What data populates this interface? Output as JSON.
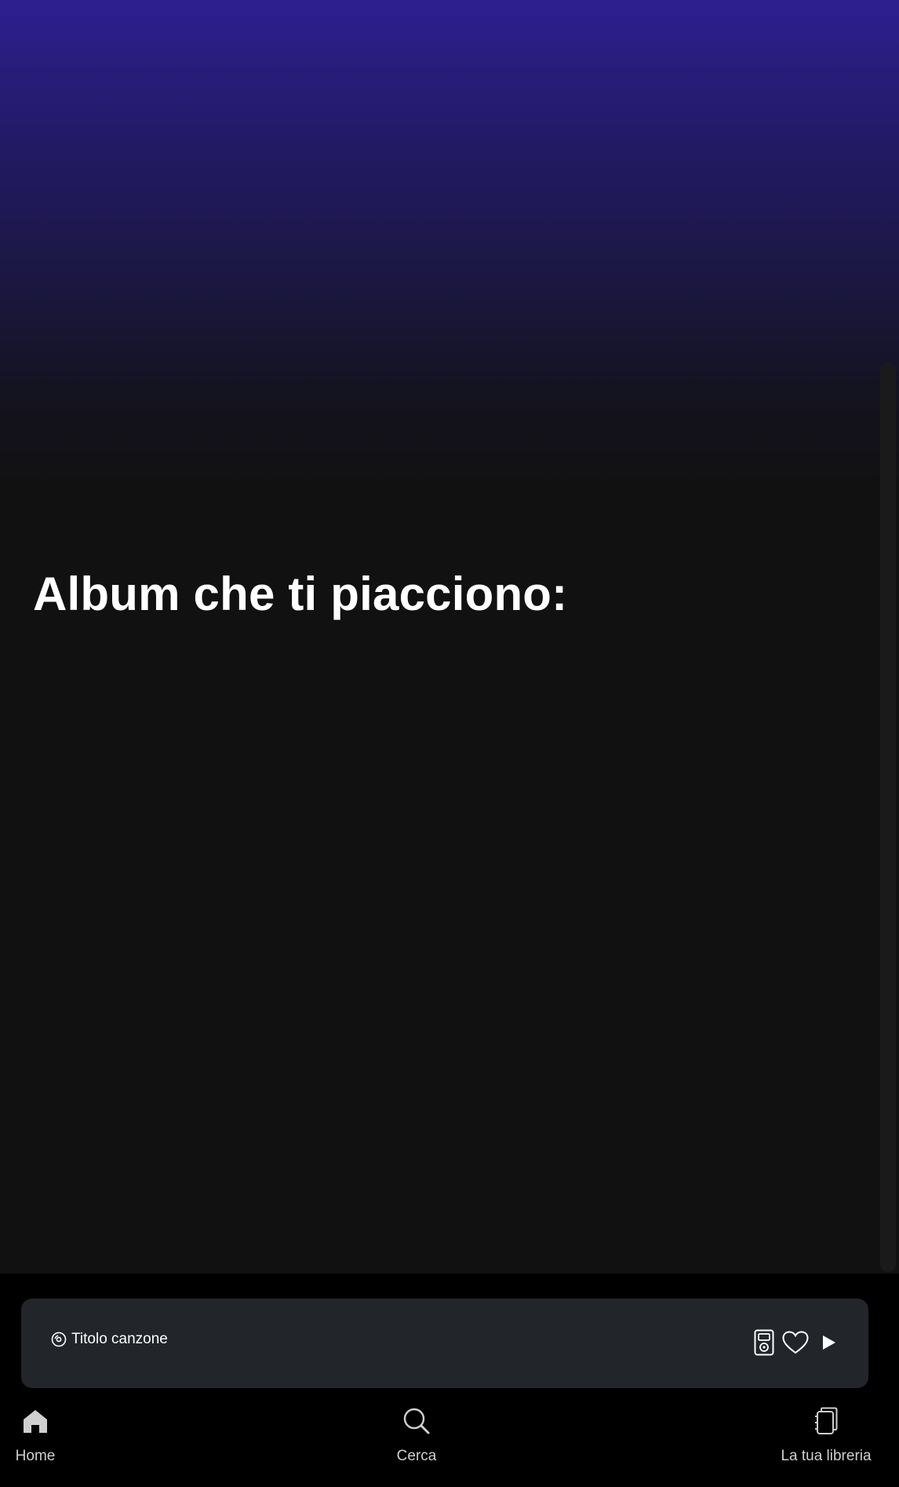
{
  "main": {
    "heading": "Album che ti piacciono:"
  },
  "player": {
    "track_title": "Titolo canzone",
    "icons": {
      "track": "disc-icon",
      "device": "speaker-device-icon",
      "like": "heart-icon",
      "play": "play-icon"
    }
  },
  "nav": {
    "items": [
      {
        "label": "Home",
        "icon": "home-icon"
      },
      {
        "label": "Cerca",
        "icon": "search-icon"
      },
      {
        "label": "La tua libreria",
        "icon": "library-icon"
      }
    ]
  },
  "colors": {
    "gradient_top": "#2e1f8f",
    "background": "#111111",
    "player_bar": "#22262a",
    "nav_background": "#000000",
    "text": "#ffffff",
    "nav_text": "#cfcfcf"
  }
}
